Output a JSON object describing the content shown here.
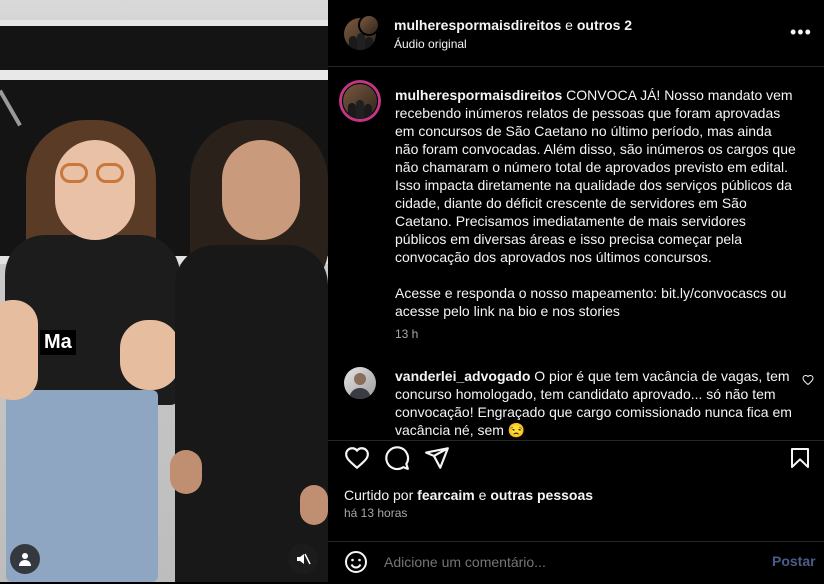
{
  "video": {
    "caption_overlay": "Ma",
    "icons": [
      "user-icon",
      "mute-icon"
    ]
  },
  "header": {
    "account": "mulherespormaisdireitos",
    "connector": " e ",
    "others": "outros 2",
    "audio": "Áudio original",
    "more_icon": "more-horizontal-icon"
  },
  "caption": {
    "username": "mulherespormaisdireitos",
    "text": "CONVOCA JÁ! Nosso mandato vem recebendo inúmeros relatos de pessoas que foram aprovadas em concursos de São Caetano no último período, mas ainda não foram convocadas. Além disso, são inúmeros os cargos que não chamaram o número total de aprovados previsto em edital. Isso impacta diretamente na qualidade dos serviços públicos da cidade, diante do déficit crescente de servidores em São Caetano. Precisamos imediatamente de mais servidores públicos em diversas áreas e isso precisa começar pela convocação dos aprovados nos últimos concursos.",
    "text2": "Acesse e responda o nosso mapeamento: bit.ly/convocascs ou acesse pelo link na bio e nos stories",
    "time": "13 h"
  },
  "comment": {
    "username": "vanderlei_advogado",
    "text": "O pior é que tem vacância de vagas, tem concurso homologado, tem candidato aprovado... só não tem convocação! Engraçado que cargo comissionado nunca fica em vacância né, sem 😒"
  },
  "actions": {
    "icons": [
      "heart-icon",
      "comment-icon",
      "share-icon",
      "bookmark-icon"
    ],
    "liked_prefix": "Curtido por ",
    "liked_user": "fearcaim",
    "liked_mid": " e ",
    "liked_rest": "outras pessoas",
    "when": "há 13 horas"
  },
  "comment_box": {
    "placeholder": "Adicione um comentário...",
    "post_label": "Postar"
  },
  "colors": {
    "background": "#000000",
    "text": "#f5f5f5",
    "muted": "#a8a8a8",
    "post_button": "#4a5d8a"
  }
}
